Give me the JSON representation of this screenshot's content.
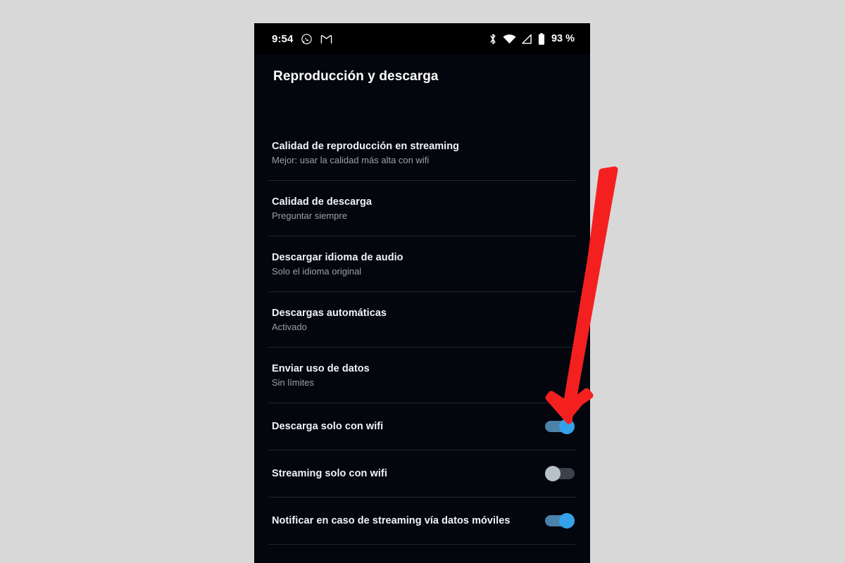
{
  "status_bar": {
    "time": "9:54",
    "left_icons": [
      "whatsapp-icon",
      "gmail-icon"
    ],
    "right_icons": [
      "bluetooth-icon",
      "wifi-icon",
      "mobile-signal-icon",
      "battery-icon"
    ],
    "battery_percent": "93 %"
  },
  "header": {
    "title": "Reproducción y descarga"
  },
  "settings": {
    "items": [
      {
        "type": "value",
        "title": "Calidad de reproducción en streaming",
        "subtitle": "Mejor: usar la calidad más alta con wifi"
      },
      {
        "type": "value",
        "title": "Calidad de descarga",
        "subtitle": "Preguntar siempre"
      },
      {
        "type": "value",
        "title": "Descargar idioma de audio",
        "subtitle": "Solo el idioma original"
      },
      {
        "type": "value",
        "title": "Descargas automáticas",
        "subtitle": "Activado"
      },
      {
        "type": "value",
        "title": "Enviar uso de datos",
        "subtitle": "Sin límites"
      },
      {
        "type": "toggle",
        "title": "Descarga solo con wifi",
        "state": "on"
      },
      {
        "type": "toggle",
        "title": "Streaming solo con wifi",
        "state": "off"
      },
      {
        "type": "toggle",
        "title": "Notificar en caso de streaming vía datos móviles",
        "state": "on"
      }
    ]
  },
  "annotation": {
    "type": "red-arrow",
    "color": "#f42020",
    "points_to": "Descarga solo con wifi toggle"
  },
  "colors": {
    "page_background": "#d8d8d8",
    "screen_background": "#03060d",
    "status_bar_background": "#000000",
    "toggle_on_thumb": "#34a2e8",
    "toggle_on_track": "#4a82aa",
    "toggle_off_thumb": "#b8c0c8",
    "toggle_off_track": "#3b424b",
    "divider": "#20262e",
    "title_text": "#ffffff",
    "subtitle_text": "#9aa0a8",
    "arrow": "#f42020"
  }
}
